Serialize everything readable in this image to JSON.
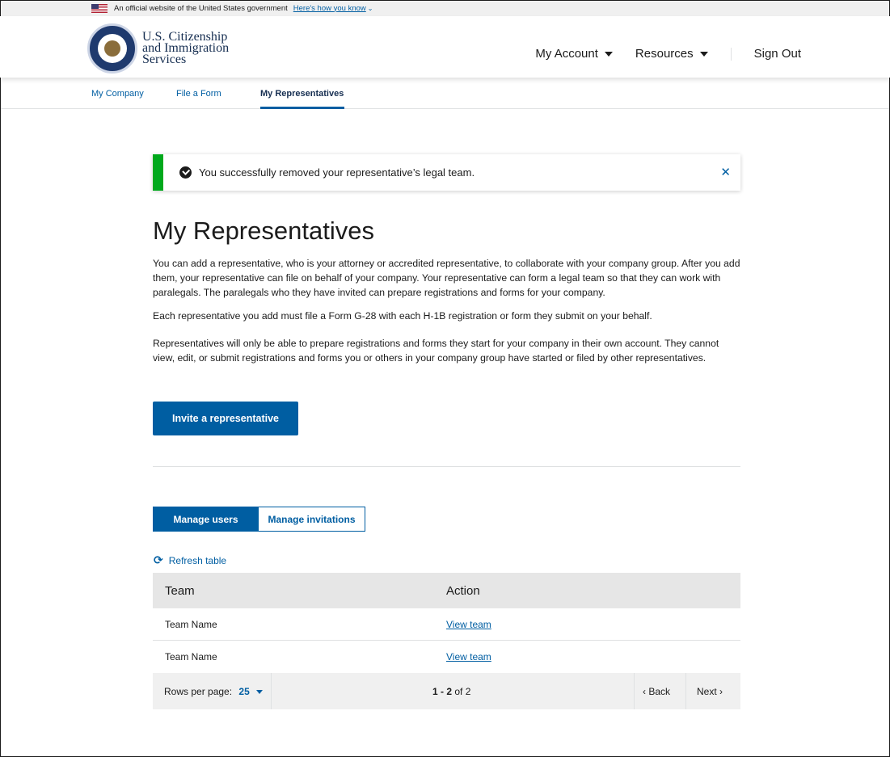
{
  "gov_banner": {
    "text": "An official website of the United States government",
    "link": "Here's how you know",
    "chevron": "⌄"
  },
  "header": {
    "logo_line1": "U.S. Citizenship",
    "logo_line2": "and Immigration",
    "logo_line3": "Services",
    "nav": {
      "my_account": "My Account",
      "resources": "Resources",
      "sign_out": "Sign Out"
    }
  },
  "subnav": {
    "tabs": [
      {
        "label": "My Company"
      },
      {
        "label": "File a Form"
      },
      {
        "label": "My Representatives"
      }
    ]
  },
  "alert": {
    "message": "You successfully removed your representative’s legal team.",
    "close": "✕"
  },
  "main": {
    "title": "My Representatives",
    "paragraphs": [
      "You can add a representative, who is your attorney or accredited representative, to collaborate with your company group. After you add them, your representative can file on behalf of your company. Your representative can form a legal team so that they can work with paralegals. The paralegals who they have invited can prepare registrations and forms for your company.",
      "Each representative you add must file a Form G-28 with each H-1B registration or form they submit on your behalf.",
      "Representatives will only be able to prepare registrations and forms they start for your company in their own account. They cannot view, edit, or submit registrations and forms you or others in your company group have started or filed by other representatives."
    ],
    "invite_button": "Invite a representative"
  },
  "segmented": {
    "manage_users": "Manage users",
    "manage_invitations": "Manage invitations"
  },
  "refresh": {
    "icon": "⟳",
    "label": "Refresh table"
  },
  "table": {
    "columns": [
      "Team",
      "Action"
    ],
    "rows": [
      {
        "team": "Team Name",
        "action": "View team"
      },
      {
        "team": "Team Name",
        "action": "View team"
      }
    ]
  },
  "pager": {
    "rows_label": "Rows per page:",
    "rows_value": "25",
    "range_bold": "1 - 2",
    "range_rest": " of 2",
    "back": "‹ Back",
    "next": "Next ›"
  },
  "colors": {
    "primary": "#005ea2",
    "success": "#00a91c",
    "navy": "#162e51"
  }
}
